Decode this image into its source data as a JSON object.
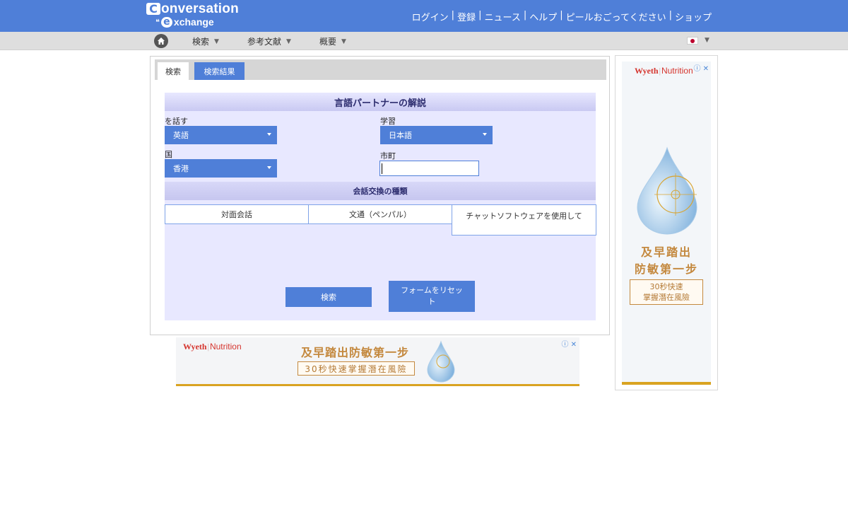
{
  "header": {
    "logo_line1": "onversation",
    "logo_c": "C",
    "logo_e": "e",
    "logo_line2": "xchange",
    "links": [
      "ログイン",
      "登録",
      "ニュース",
      "ヘルプ",
      "ピールおごってください",
      "ショップ"
    ],
    "separator": "|"
  },
  "nav": {
    "items": [
      "検索",
      "参考文献",
      "概要"
    ],
    "language_flag": "japan-flag"
  },
  "tabs": [
    {
      "label": "検索",
      "active": true
    },
    {
      "label": "検索結果",
      "active": false
    }
  ],
  "form": {
    "title": "言語パートナーの解説",
    "speaks_label": "を話す",
    "speaks_value": "英語",
    "learning_label": "学習",
    "learning_value": "日本語",
    "country_label": "国",
    "country_value": "香港",
    "city_label": "市町",
    "city_value": "",
    "exchange_type_title": "会話交換の種類",
    "exchange_types": [
      "対面会話",
      "文通（ペンパル）",
      "チャットソフトウェアを使用して"
    ],
    "search_button": "検索",
    "reset_button": "フォームをリセット"
  },
  "ads": {
    "brand": "Wyeth",
    "brand_sub": "Nutrition",
    "headline": "及早踏出防敏第一步",
    "headline_side_1": "及早踏出",
    "headline_side_2": "防敏第一步",
    "cta": "30秒快速掌握潛在風險",
    "cta_side_1": "30秒快速",
    "cta_side_2": "掌握潛在風險",
    "ad_icons": "ⓘ ✕"
  },
  "colors": {
    "brand_blue": "#4f7fd8",
    "form_bg": "#e8e8ff",
    "nav_bg": "#dedede"
  }
}
